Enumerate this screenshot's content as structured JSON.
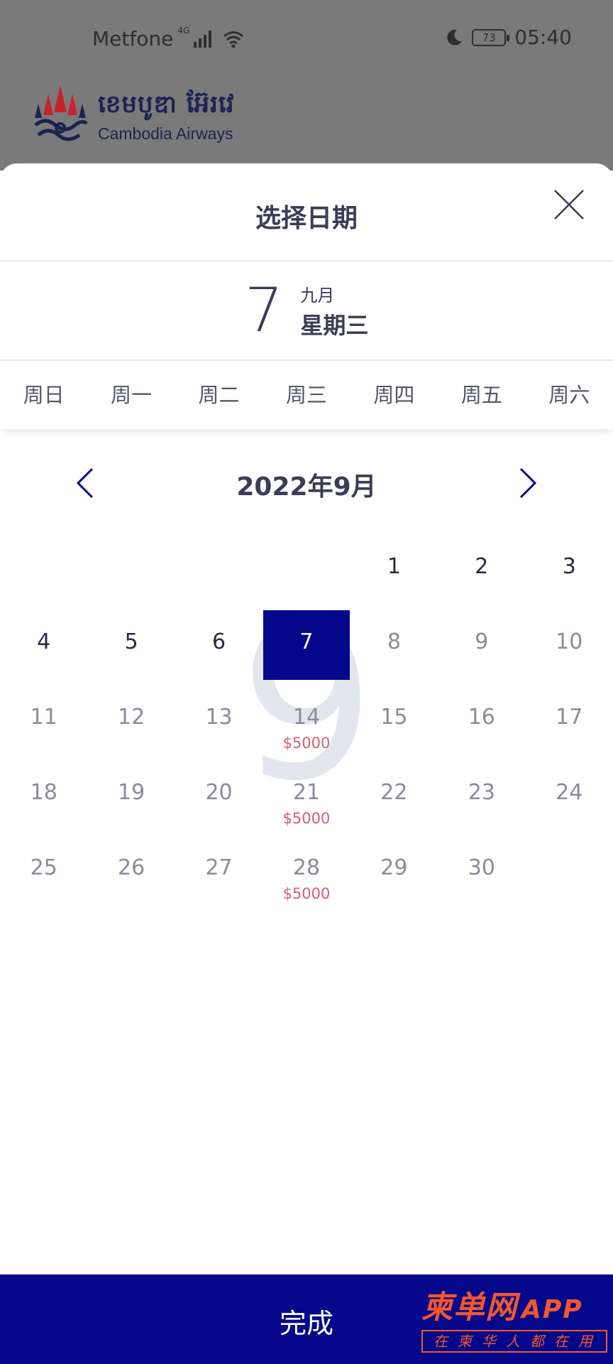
{
  "status_bar": {
    "carrier": "Metfone",
    "network": "4G",
    "battery": "73",
    "time": "05:40"
  },
  "background_app": {
    "logo_khmer": "ខេមបូឌា អ៊ែរវេ",
    "logo_english": "Cambodia Airways"
  },
  "sheet": {
    "title": "选择日期",
    "selected": {
      "day": "7",
      "month": "九月",
      "weekday": "星期三"
    },
    "weekdays": [
      "周日",
      "周一",
      "周二",
      "周三",
      "周四",
      "周五",
      "周六"
    ],
    "month_title": "2022年9月",
    "watermark_digit": "9",
    "weeks": [
      [
        {
          "day": ""
        },
        {
          "day": ""
        },
        {
          "day": ""
        },
        {
          "day": ""
        },
        {
          "day": "1",
          "active": true
        },
        {
          "day": "2",
          "active": true
        },
        {
          "day": "3",
          "active": true
        }
      ],
      [
        {
          "day": "4",
          "active": true
        },
        {
          "day": "5",
          "active": true
        },
        {
          "day": "6",
          "active": true
        },
        {
          "day": "7",
          "selected": true
        },
        {
          "day": "8"
        },
        {
          "day": "9"
        },
        {
          "day": "10"
        }
      ],
      [
        {
          "day": "11"
        },
        {
          "day": "12"
        },
        {
          "day": "13"
        },
        {
          "day": "14",
          "price": "$5000"
        },
        {
          "day": "15"
        },
        {
          "day": "16"
        },
        {
          "day": "17"
        }
      ],
      [
        {
          "day": "18"
        },
        {
          "day": "19"
        },
        {
          "day": "20"
        },
        {
          "day": "21",
          "price": "$5000"
        },
        {
          "day": "22"
        },
        {
          "day": "23"
        },
        {
          "day": "24"
        }
      ],
      [
        {
          "day": "25"
        },
        {
          "day": "26"
        },
        {
          "day": "27"
        },
        {
          "day": "28",
          "price": "$5000"
        },
        {
          "day": "29"
        },
        {
          "day": "30"
        },
        {
          "day": ""
        }
      ]
    ],
    "confirm_label": "完成"
  },
  "watermark_brand": {
    "name": "柬单网",
    "app": "APP",
    "slogan": "在柬华人都在用"
  },
  "colors": {
    "primary": "#05088a",
    "price": "#d46073",
    "text": "#3c3d55",
    "brand": "#f0572d"
  }
}
